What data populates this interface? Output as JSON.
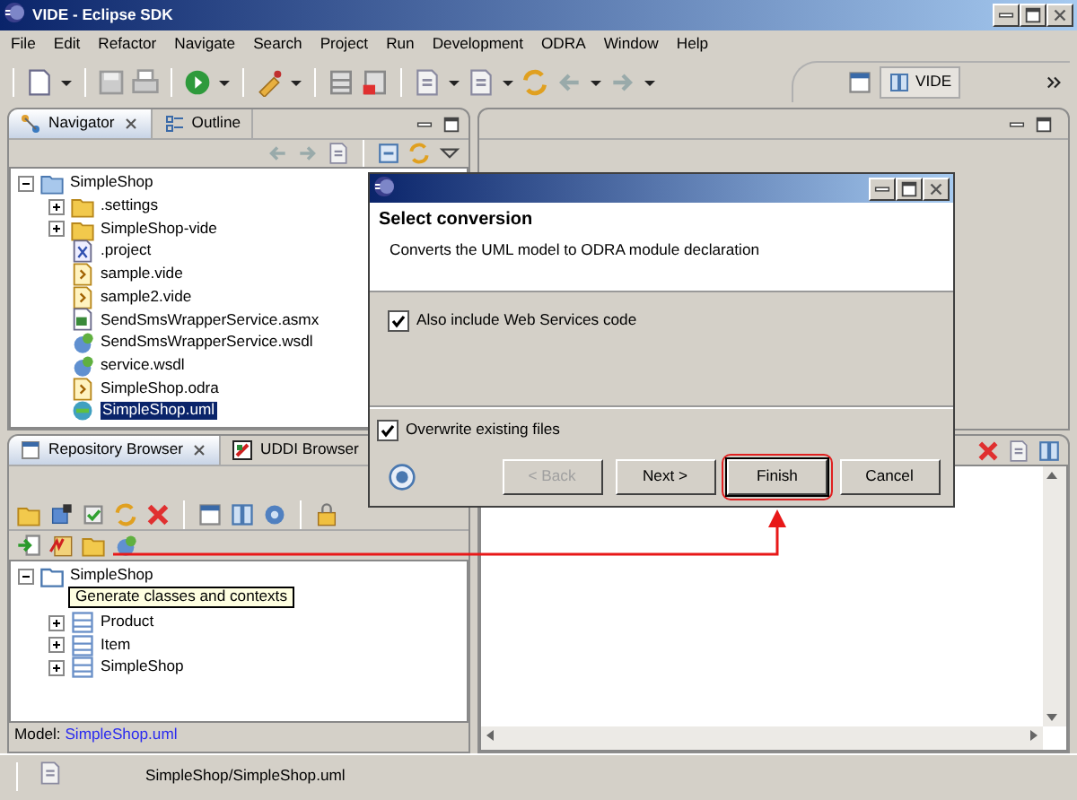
{
  "window": {
    "title": "VIDE - Eclipse SDK"
  },
  "menu": [
    "File",
    "Edit",
    "Refactor",
    "Navigate",
    "Search",
    "Project",
    "Run",
    "Development",
    "ODRA",
    "Window",
    "Help"
  ],
  "perspective": {
    "label": "VIDE"
  },
  "navigator": {
    "tabs": [
      {
        "label": "Navigator",
        "selected": true
      },
      {
        "label": "Outline",
        "selected": false
      }
    ],
    "tree": [
      {
        "label": "SimpleShop",
        "kind": "project",
        "expanded": true,
        "selected": false,
        "children": [
          {
            "label": ".settings",
            "kind": "folder",
            "expanded": false,
            "selected": false
          },
          {
            "label": "SimpleShop-vide",
            "kind": "folder",
            "expanded": false,
            "selected": false
          },
          {
            "label": ".project",
            "kind": "xml",
            "selected": false
          },
          {
            "label": "sample.vide",
            "kind": "vide",
            "selected": false
          },
          {
            "label": "sample2.vide",
            "kind": "vide",
            "selected": false
          },
          {
            "label": "SendSmsWrapperService.asmx",
            "kind": "asmx",
            "selected": false
          },
          {
            "label": "SendSmsWrapperService.wsdl",
            "kind": "wsdl",
            "selected": false
          },
          {
            "label": "service.wsdl",
            "kind": "wsdl",
            "selected": false
          },
          {
            "label": "SimpleShop.odra",
            "kind": "vide",
            "selected": false
          },
          {
            "label": "SimpleShop.uml",
            "kind": "uml",
            "selected": true
          }
        ]
      }
    ]
  },
  "repository_browser": {
    "tabs": [
      {
        "label": "Repository Browser",
        "selected": true
      },
      {
        "label": "UDDI Browser",
        "selected": false
      }
    ],
    "tree": [
      {
        "label": "SimpleShop",
        "kind": "package",
        "expanded": true,
        "children": [
          {
            "label": "Product",
            "kind": "class",
            "expanded": false
          },
          {
            "label": "Item",
            "kind": "class",
            "expanded": false
          },
          {
            "label": "SimpleShop",
            "kind": "class",
            "expanded": false
          }
        ]
      }
    ],
    "model_label": "Model:",
    "model_file": "SimpleShop.uml"
  },
  "tooltip": "Generate classes and contexts",
  "dialog": {
    "heading": "Select conversion",
    "description": "Converts the UML model to ODRA module declaration",
    "options": [
      {
        "label": "Also include Web Services code",
        "checked": true
      },
      {
        "label": "Overwrite existing files",
        "checked": true
      }
    ],
    "buttons": [
      {
        "label": "< Back",
        "disabled": true,
        "default": false,
        "highlighted": false
      },
      {
        "label": "Next >",
        "disabled": false,
        "default": false,
        "highlighted": false
      },
      {
        "label": "Finish",
        "disabled": false,
        "default": true,
        "highlighted": true
      },
      {
        "label": "Cancel",
        "disabled": false,
        "default": false,
        "highlighted": false
      }
    ]
  },
  "status_bar": {
    "path": "SimpleShop/SimpleShop.uml"
  }
}
